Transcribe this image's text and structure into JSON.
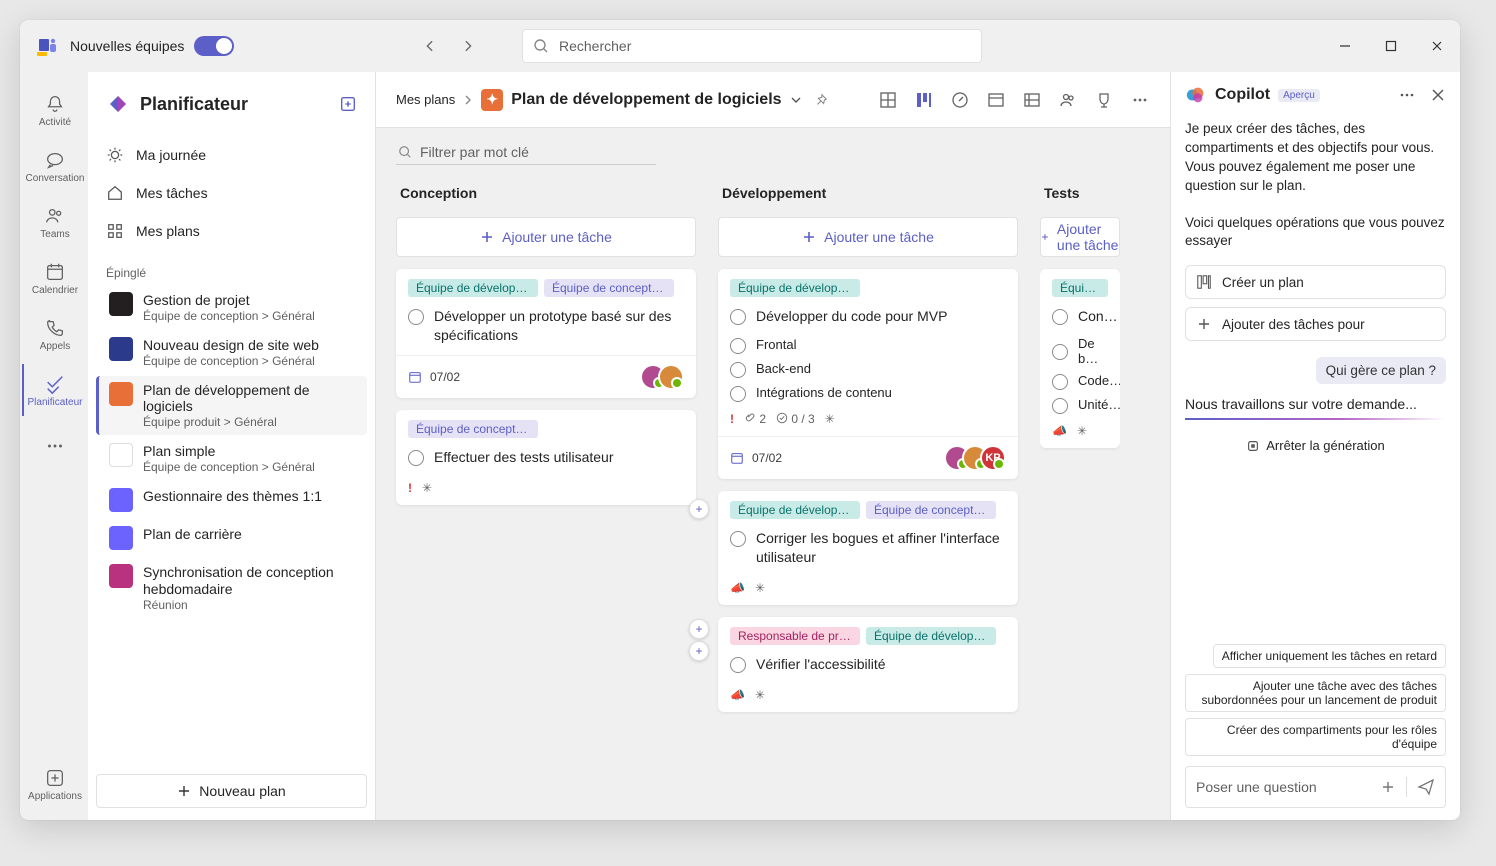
{
  "titlebar": {
    "app_title": "Nouvelles équipes",
    "search_placeholder": "Rechercher"
  },
  "rail": [
    {
      "id": "activity",
      "label": "Activité"
    },
    {
      "id": "chat",
      "label": "Conversation"
    },
    {
      "id": "teams",
      "label": "Teams"
    },
    {
      "id": "calendar",
      "label": "Calendrier"
    },
    {
      "id": "calls",
      "label": "Appels"
    },
    {
      "id": "planner",
      "label": "Planificateur"
    },
    {
      "id": "more",
      "label": ""
    },
    {
      "id": "apps",
      "label": "Applications"
    }
  ],
  "sidebar": {
    "title": "Planificateur",
    "nav": {
      "day": {
        "label": "Ma journée"
      },
      "tasks": {
        "label": "Mes tâches"
      },
      "plans": {
        "label": "Mes plans"
      }
    },
    "pinned_header": "Épinglé",
    "pinned": [
      {
        "title": "Gestion de projet",
        "sub": "Équipe de conception > Général",
        "color": "#231f20"
      },
      {
        "title": "Nouveau design de site web",
        "sub": "Équipe de conception > Général",
        "color": "#2b3a8a"
      },
      {
        "title": "Plan de développement de logiciels",
        "sub": "Équipe produit > Général",
        "color": "#e96f39"
      },
      {
        "title": "Plan simple",
        "sub": "Équipe de conception > Général",
        "color": "#ffffff"
      },
      {
        "title": "Gestionnaire des thèmes 1:1",
        "sub": "",
        "color": "#6c63ff"
      },
      {
        "title": "Plan de carrière",
        "sub": "",
        "color": "#6c63ff"
      },
      {
        "title": "Synchronisation de conception hebdomadaire",
        "sub": "Réunion",
        "color": "#b83280"
      }
    ],
    "new_plan": "Nouveau plan"
  },
  "header": {
    "crumb_root": "Mes plans",
    "plan_title": "Plan de développement de logiciels"
  },
  "filter": {
    "placeholder": "Filtrer par mot clé"
  },
  "board": {
    "add_label": "Ajouter une tâche",
    "buckets": [
      {
        "name": "Conception",
        "cards": [
          {
            "tags": [
              {
                "text": "Équipe de développ…",
                "cls": "teal"
              },
              {
                "text": "Équipe de conception",
                "cls": "purple"
              }
            ],
            "title": "Développer un prototype basé sur des spécifications",
            "due": "07/02",
            "avatars": [
              "#b24a8f",
              "#d78b3a"
            ]
          },
          {
            "tags": [
              {
                "text": "Équipe de conception",
                "cls": "purple"
              }
            ],
            "title": "Effectuer des tests utilisateur",
            "priority": true
          }
        ]
      },
      {
        "name": "Développement",
        "cards": [
          {
            "tags": [
              {
                "text": "Équipe de développ…",
                "cls": "teal"
              }
            ],
            "title": "Développer du code pour MVP",
            "subs": [
              "Frontal",
              "Back-end",
              "Intégrations de contenu"
            ],
            "attach": "2",
            "check": "0 / 3",
            "due": "07/02",
            "avatars": [
              "#b24a8f",
              "#d78b3a",
              "#d13438"
            ],
            "avatar_labels": [
              "",
              "",
              "KP"
            ],
            "priority": true
          },
          {
            "tags": [
              {
                "text": "Équipe de développ…",
                "cls": "teal"
              },
              {
                "text": "Équipe de conception",
                "cls": "purple"
              }
            ],
            "title": "Corriger les bogues et affiner l'interface utilisateur",
            "horn": true
          },
          {
            "tags": [
              {
                "text": "Responsable de pro…",
                "cls": "pink"
              },
              {
                "text": "Équipe de développ…",
                "cls": "teal"
              }
            ],
            "title": "Vérifier l'accessibilité",
            "horn": true
          }
        ]
      },
      {
        "name": "Tests",
        "cards": [
          {
            "tags": [
              {
                "text": "Équipe de d…",
                "cls": "teal"
              }
            ],
            "title": "Con…",
            "subs": [
              "De b…",
              "Code…",
              "Unité…"
            ],
            "horn": true
          }
        ]
      }
    ]
  },
  "copilot": {
    "title": "Copilot",
    "badge": "Aperçu",
    "intro1": "Je peux créer des tâches, des compartiments et des objectifs pour vous. Vous pouvez également me poser une question sur le plan.",
    "intro2": "Voici quelques opérations que vous pouvez essayer",
    "chips": {
      "create": "Créer un plan",
      "add": "Ajouter des tâches pour"
    },
    "user_msg": "Qui gère ce plan ?",
    "asst_msg": "Nous travaillons sur votre demande...",
    "stop": "Arrêter la génération",
    "suggestions": [
      "Afficher uniquement les tâches en retard",
      "Ajouter une tâche avec des tâches subordonnées pour un lancement de produit",
      "Créer des compartiments pour les rôles d'équipe"
    ],
    "placeholder": "Poser une question"
  }
}
